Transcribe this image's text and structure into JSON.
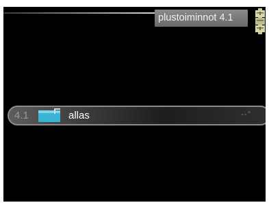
{
  "header": {
    "title": "plustoiminnot 4.1"
  },
  "row": {
    "number": "4.1",
    "label": "allas",
    "value": "--°"
  },
  "icons": {
    "scroll": "scroll-indicator-icon",
    "pool": "pool-icon"
  },
  "colors": {
    "screen_bg": "#000000",
    "title_bg": "#7b7b7b",
    "pool_icon": "#3ab4d4",
    "scroll_icon": "#c8c89a"
  }
}
